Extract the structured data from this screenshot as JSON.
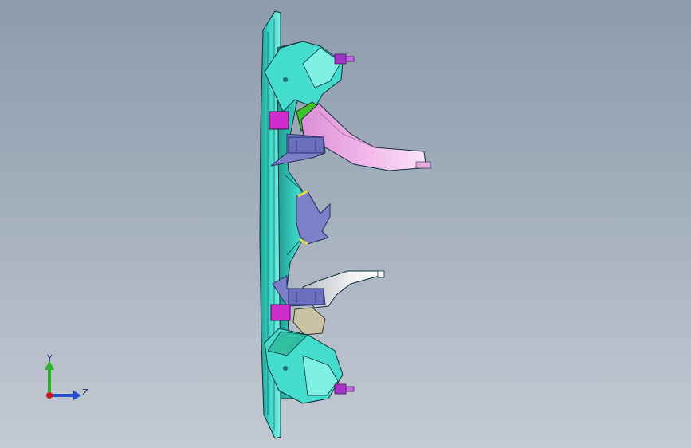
{
  "viewport": {
    "background_top": "#8d9bab",
    "background_bottom": "#c3cad3"
  },
  "model": {
    "colors": {
      "frame": "#38d3c4",
      "frame_dark": "#1e9c90",
      "frame_light": "#7ff0e4",
      "pink_arm": "#f2b7ea",
      "white_arm": "#eceeef",
      "bracket": "#7b80c8",
      "bracket_dark": "#4f5496",
      "magenta_block": "#cc2dcc",
      "green_block": "#3fbf2a",
      "tan_block": "#c9c2a3",
      "bolt": "#a335c9",
      "yellow_edge": "#e6d84a",
      "outline": "#10303a"
    }
  },
  "triad": {
    "y_label": "Y",
    "z_label": "Z",
    "y_color": "#2fae2f",
    "z_color": "#2a4fd6",
    "origin_color": "#d21c1c"
  }
}
